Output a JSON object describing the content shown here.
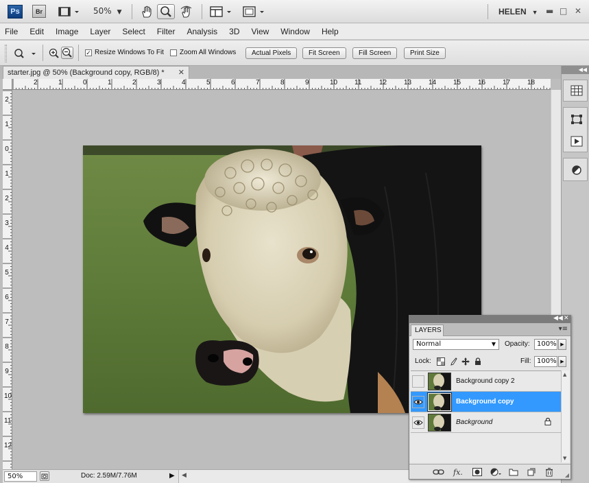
{
  "appbar": {
    "ps_label": "Ps",
    "br_label": "Br",
    "zoom_level": "50%",
    "user": "HELEN"
  },
  "menu": [
    "File",
    "Edit",
    "Image",
    "Layer",
    "Select",
    "Filter",
    "Analysis",
    "3D",
    "View",
    "Window",
    "Help"
  ],
  "options": {
    "resize_windows_label": "Resize Windows To Fit",
    "resize_windows_checked": true,
    "zoom_all_label": "Zoom All Windows",
    "zoom_all_checked": false,
    "actual_pixels": "Actual Pixels",
    "fit_screen": "Fit Screen",
    "fill_screen": "Fill Screen",
    "print_size": "Print Size"
  },
  "document": {
    "tab_title": "starter.jpg @ 50% (Background copy, RGB/8) *"
  },
  "rulers": {
    "h": [
      "2",
      "1",
      "0",
      "1",
      "2",
      "3",
      "4",
      "5",
      "6",
      "7",
      "8",
      "9",
      "10",
      "11",
      "12",
      "13",
      "14",
      "15",
      "16",
      "17",
      "18"
    ],
    "v": [
      "2",
      "1",
      "0",
      "1",
      "2",
      "3",
      "4",
      "5",
      "6",
      "7",
      "8",
      "9",
      "10",
      "11",
      "12"
    ]
  },
  "status": {
    "zoom": "50%",
    "doc_info": "Doc: 2.59M/7.76M"
  },
  "layers_panel": {
    "tab_label": "LAYERS",
    "blend_mode": "Normal",
    "opacity_label": "Opacity:",
    "opacity_value": "100%",
    "lock_label": "Lock:",
    "fill_label": "Fill:",
    "fill_value": "100%",
    "layers": [
      {
        "name": "Background copy 2",
        "visible": false,
        "selected": false,
        "italic": false,
        "locked": false
      },
      {
        "name": "Background copy",
        "visible": true,
        "selected": true,
        "italic": false,
        "locked": false
      },
      {
        "name": "Background",
        "visible": true,
        "selected": false,
        "italic": true,
        "locked": true
      }
    ]
  },
  "colors": {
    "selection": "#3399ff",
    "workspace": "#bdbdbd"
  }
}
